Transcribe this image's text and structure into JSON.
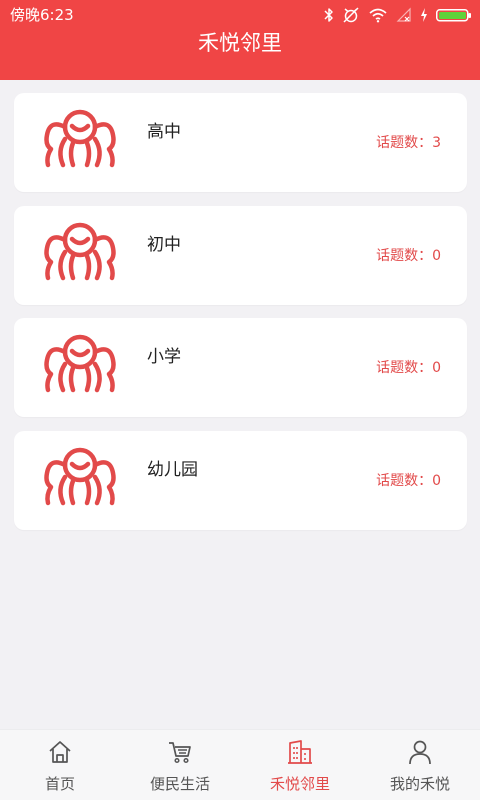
{
  "status_bar": {
    "time": "傍晚6:23"
  },
  "header": {
    "title": "禾悦邻里"
  },
  "cards": [
    {
      "title": "高中",
      "count": "话题数：3",
      "icon": "people-group-icon"
    },
    {
      "title": "初中",
      "count": "话题数：0",
      "icon": "people-group-icon"
    },
    {
      "title": "小学",
      "count": "话题数：0",
      "icon": "people-group-icon"
    },
    {
      "title": "幼儿园",
      "count": "话题数：0",
      "icon": "people-group-icon"
    }
  ],
  "tabbar": {
    "tabs": [
      {
        "label": "首页",
        "icon": "home-icon",
        "active": false
      },
      {
        "label": "便民生活",
        "icon": "cart-icon",
        "active": false
      },
      {
        "label": "禾悦邻里",
        "icon": "building-icon",
        "active": true
      },
      {
        "label": "我的禾悦",
        "icon": "person-icon",
        "active": false
      }
    ]
  },
  "colors": {
    "accent": "#f04545",
    "count_text": "#e24a4a",
    "background": "#f2f1f4"
  }
}
